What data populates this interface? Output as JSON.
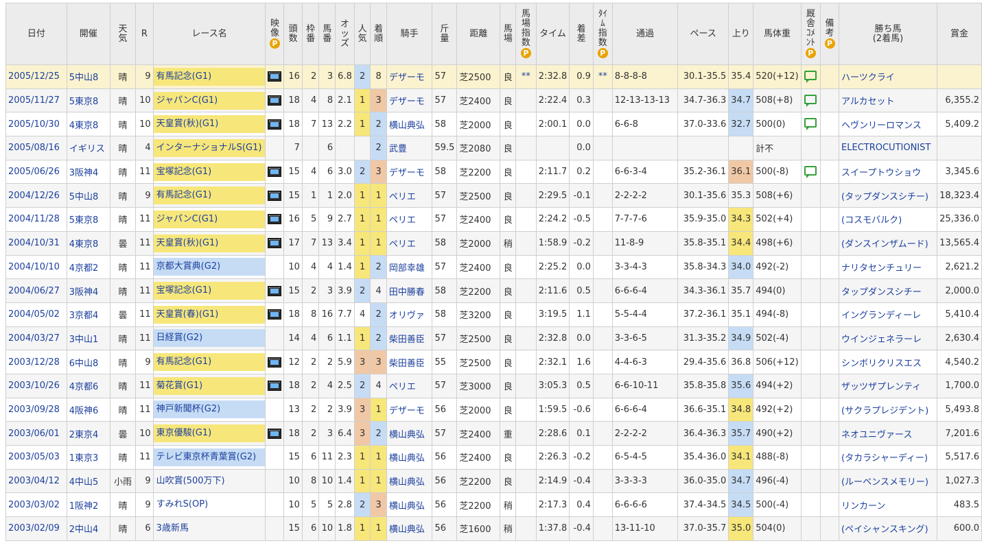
{
  "headers": {
    "date": "日付",
    "venue": "開催",
    "weather": "天気",
    "race_no": "R",
    "race_name": "レース名",
    "video": "映像",
    "video_badge": "P",
    "runners": "頭数",
    "bracket": "枠番",
    "horse_no": "馬番",
    "odds": "オッズ",
    "popularity": "人気",
    "finish": "着順",
    "jockey": "騎手",
    "weight_carried": "斤量",
    "distance": "距離",
    "track": "馬場",
    "track_index": "馬場指数",
    "track_index_badge": "P",
    "time": "タイム",
    "margin": "着差",
    "time_index": "ﾀｲﾑ指数",
    "time_index_badge": "P",
    "passing": "通過",
    "pace": "ペース",
    "last3f": "上り",
    "body_weight": "馬体重",
    "stable_comment": "厩舎ｺﾒﾝﾄ",
    "stable_comment_badge": "P",
    "notes": "備考",
    "notes_badge": "P",
    "winner_l1": "勝ち馬",
    "winner_l2": "(2着馬)",
    "prize": "賞金"
  },
  "rows": [
    {
      "date": "2005/12/25",
      "venue": "5中山8",
      "weather": "晴",
      "race_no": "9",
      "race_name": "有馬記念(G1)",
      "grade": "g1",
      "video": true,
      "runners": "16",
      "bracket": "2",
      "horse_no": "3",
      "odds": "6.8",
      "popularity": "2",
      "finish": "8",
      "jockey": "デザーモ",
      "weight_carried": "57",
      "distance": "芝2500",
      "track": "良",
      "track_index": "**",
      "time": "2:32.8",
      "margin": "0.9",
      "time_index": "**",
      "passing": "8-8-8-8",
      "pace": "30.1-35.5",
      "last3f": "35.4",
      "body_weight": "520(+12)",
      "comment": true,
      "notes": "",
      "winner": "ハーツクライ",
      "prize": ""
    },
    {
      "date": "2005/11/27",
      "venue": "5東京8",
      "weather": "晴",
      "race_no": "10",
      "race_name": "ジャパンC(G1)",
      "grade": "g1",
      "video": true,
      "runners": "18",
      "bracket": "4",
      "horse_no": "8",
      "odds": "2.1",
      "popularity": "1",
      "finish": "3",
      "jockey": "デザーモ",
      "weight_carried": "57",
      "distance": "芝2400",
      "track": "良",
      "track_index": "",
      "time": "2:22.4",
      "margin": "0.3",
      "time_index": "",
      "passing": "12-13-13-13",
      "pace": "34.7-36.3",
      "last3f": "34.7",
      "body_weight": "508(+8)",
      "comment": true,
      "notes": "",
      "winner": "アルカセット",
      "prize": "6,355.2"
    },
    {
      "date": "2005/10/30",
      "venue": "4東京8",
      "weather": "晴",
      "race_no": "10",
      "race_name": "天皇賞(秋)(G1)",
      "grade": "g1",
      "video": true,
      "runners": "18",
      "bracket": "7",
      "horse_no": "13",
      "odds": "2.2",
      "popularity": "1",
      "finish": "2",
      "jockey": "横山典弘",
      "weight_carried": "58",
      "distance": "芝2000",
      "track": "良",
      "track_index": "",
      "time": "2:00.1",
      "margin": "0.0",
      "time_index": "",
      "passing": "6-6-8",
      "pace": "37.0-33.6",
      "last3f": "32.7",
      "body_weight": "500(0)",
      "comment": true,
      "notes": "",
      "winner": "ヘヴンリーロマンス",
      "prize": "5,409.2"
    },
    {
      "date": "2005/08/16",
      "venue": "イギリス",
      "weather": "晴",
      "race_no": "4",
      "race_name": "インターナショナルS(G1)",
      "grade": "g1",
      "video": false,
      "runners": "7",
      "bracket": "",
      "horse_no": "6",
      "odds": "",
      "popularity": "",
      "finish": "2",
      "jockey": "武豊",
      "weight_carried": "59.5",
      "distance": "芝2080",
      "track": "良",
      "track_index": "",
      "time": "",
      "margin": "0.0",
      "time_index": "",
      "passing": "",
      "pace": "",
      "last3f": "",
      "body_weight": "計不",
      "comment": false,
      "notes": "",
      "winner": "ELECTROCUTIONIST",
      "prize": ""
    },
    {
      "date": "2005/06/26",
      "venue": "3阪神4",
      "weather": "晴",
      "race_no": "11",
      "race_name": "宝塚記念(G1)",
      "grade": "g1",
      "video": true,
      "runners": "15",
      "bracket": "4",
      "horse_no": "6",
      "odds": "3.0",
      "popularity": "2",
      "finish": "3",
      "jockey": "デザーモ",
      "weight_carried": "58",
      "distance": "芝2200",
      "track": "良",
      "track_index": "",
      "time": "2:11.7",
      "margin": "0.2",
      "time_index": "",
      "passing": "6-6-3-4",
      "pace": "35.2-36.1",
      "last3f": "36.1",
      "body_weight": "500(-8)",
      "comment": true,
      "notes": "",
      "winner": "スイープトウショウ",
      "prize": "3,345.6"
    },
    {
      "date": "2004/12/26",
      "venue": "5中山8",
      "weather": "晴",
      "race_no": "9",
      "race_name": "有馬記念(G1)",
      "grade": "g1",
      "video": true,
      "runners": "15",
      "bracket": "1",
      "horse_no": "1",
      "odds": "2.0",
      "popularity": "1",
      "finish": "1",
      "jockey": "ペリエ",
      "weight_carried": "57",
      "distance": "芝2500",
      "track": "良",
      "track_index": "",
      "time": "2:29.5",
      "margin": "-0.1",
      "time_index": "",
      "passing": "2-2-2-2",
      "pace": "30.1-35.6",
      "last3f": "35.3",
      "body_weight": "508(+6)",
      "comment": false,
      "notes": "",
      "winner": "(タップダンスシチー)",
      "prize": "18,323.4"
    },
    {
      "date": "2004/11/28",
      "venue": "5東京8",
      "weather": "晴",
      "race_no": "11",
      "race_name": "ジャパンC(G1)",
      "grade": "g1",
      "video": true,
      "runners": "16",
      "bracket": "5",
      "horse_no": "9",
      "odds": "2.7",
      "popularity": "1",
      "finish": "1",
      "jockey": "ペリエ",
      "weight_carried": "57",
      "distance": "芝2400",
      "track": "良",
      "track_index": "",
      "time": "2:24.2",
      "margin": "-0.5",
      "time_index": "",
      "passing": "7-7-7-6",
      "pace": "35.9-35.0",
      "last3f": "34.3",
      "body_weight": "502(+4)",
      "comment": false,
      "notes": "",
      "winner": "(コスモバルク)",
      "prize": "25,336.0"
    },
    {
      "date": "2004/10/31",
      "venue": "4東京8",
      "weather": "曇",
      "race_no": "11",
      "race_name": "天皇賞(秋)(G1)",
      "grade": "g1",
      "video": true,
      "runners": "17",
      "bracket": "7",
      "horse_no": "13",
      "odds": "3.4",
      "popularity": "1",
      "finish": "1",
      "jockey": "ペリエ",
      "weight_carried": "58",
      "distance": "芝2000",
      "track": "稍",
      "track_index": "",
      "time": "1:58.9",
      "margin": "-0.2",
      "time_index": "",
      "passing": "11-8-9",
      "pace": "35.8-35.1",
      "last3f": "34.4",
      "body_weight": "498(+6)",
      "comment": false,
      "notes": "",
      "winner": "(ダンスインザムード)",
      "prize": "13,565.4"
    },
    {
      "date": "2004/10/10",
      "venue": "4京都2",
      "weather": "晴",
      "race_no": "11",
      "race_name": "京都大賞典(G2)",
      "grade": "g2",
      "video": false,
      "runners": "10",
      "bracket": "4",
      "horse_no": "4",
      "odds": "1.4",
      "popularity": "1",
      "finish": "2",
      "jockey": "岡部幸雄",
      "weight_carried": "57",
      "distance": "芝2400",
      "track": "良",
      "track_index": "",
      "time": "2:25.2",
      "margin": "0.0",
      "time_index": "",
      "passing": "3-3-4-3",
      "pace": "35.8-34.3",
      "last3f": "34.0",
      "body_weight": "492(-2)",
      "comment": false,
      "notes": "",
      "winner": "ナリタセンチュリー",
      "prize": "2,621.2"
    },
    {
      "date": "2004/06/27",
      "venue": "3阪神4",
      "weather": "晴",
      "race_no": "11",
      "race_name": "宝塚記念(G1)",
      "grade": "g1",
      "video": true,
      "runners": "15",
      "bracket": "2",
      "horse_no": "3",
      "odds": "3.9",
      "popularity": "2",
      "finish": "4",
      "jockey": "田中勝春",
      "weight_carried": "58",
      "distance": "芝2200",
      "track": "良",
      "track_index": "",
      "time": "2:11.6",
      "margin": "0.5",
      "time_index": "",
      "passing": "6-6-6-4",
      "pace": "34.3-36.1",
      "last3f": "35.7",
      "body_weight": "494(0)",
      "comment": false,
      "notes": "",
      "winner": "タップダンスシチー",
      "prize": "2,000.0"
    },
    {
      "date": "2004/05/02",
      "venue": "3京都4",
      "weather": "曇",
      "race_no": "11",
      "race_name": "天皇賞(春)(G1)",
      "grade": "g1",
      "video": true,
      "runners": "18",
      "bracket": "8",
      "horse_no": "16",
      "odds": "7.7",
      "popularity": "4",
      "finish": "2",
      "jockey": "オリヴァ",
      "weight_carried": "58",
      "distance": "芝3200",
      "track": "良",
      "track_index": "",
      "time": "3:19.5",
      "margin": "1.1",
      "time_index": "",
      "passing": "5-5-4-4",
      "pace": "37.2-36.1",
      "last3f": "35.1",
      "body_weight": "494(-8)",
      "comment": false,
      "notes": "",
      "winner": "イングランディーレ",
      "prize": "5,410.4"
    },
    {
      "date": "2004/03/27",
      "venue": "3中山1",
      "weather": "晴",
      "race_no": "11",
      "race_name": "日経賞(G2)",
      "grade": "g2",
      "video": false,
      "runners": "14",
      "bracket": "4",
      "horse_no": "6",
      "odds": "1.1",
      "popularity": "1",
      "finish": "2",
      "jockey": "柴田善臣",
      "weight_carried": "57",
      "distance": "芝2500",
      "track": "良",
      "track_index": "",
      "time": "2:32.8",
      "margin": "0.0",
      "time_index": "",
      "passing": "3-3-6-5",
      "pace": "31.3-35.2",
      "last3f": "34.9",
      "body_weight": "502(-4)",
      "comment": false,
      "notes": "",
      "winner": "ウインジェネラーレ",
      "prize": "2,630.4"
    },
    {
      "date": "2003/12/28",
      "venue": "6中山8",
      "weather": "晴",
      "race_no": "9",
      "race_name": "有馬記念(G1)",
      "grade": "g1",
      "video": true,
      "runners": "12",
      "bracket": "2",
      "horse_no": "2",
      "odds": "5.9",
      "popularity": "3",
      "finish": "3",
      "jockey": "柴田善臣",
      "weight_carried": "55",
      "distance": "芝2500",
      "track": "良",
      "track_index": "",
      "time": "2:32.1",
      "margin": "1.6",
      "time_index": "",
      "passing": "4-4-6-3",
      "pace": "29.4-35.6",
      "last3f": "36.8",
      "body_weight": "506(+12)",
      "comment": false,
      "notes": "",
      "winner": "シンボリクリスエス",
      "prize": "4,540.2"
    },
    {
      "date": "2003/10/26",
      "venue": "4京都6",
      "weather": "晴",
      "race_no": "11",
      "race_name": "菊花賞(G1)",
      "grade": "g1",
      "video": true,
      "runners": "18",
      "bracket": "2",
      "horse_no": "4",
      "odds": "2.5",
      "popularity": "2",
      "finish": "4",
      "jockey": "ペリエ",
      "weight_carried": "57",
      "distance": "芝3000",
      "track": "良",
      "track_index": "",
      "time": "3:05.3",
      "margin": "0.5",
      "time_index": "",
      "passing": "6-6-10-11",
      "pace": "35.8-35.8",
      "last3f": "35.6",
      "body_weight": "494(+2)",
      "comment": false,
      "notes": "",
      "winner": "ザッツザプレンティ",
      "prize": "1,700.0"
    },
    {
      "date": "2003/09/28",
      "venue": "4阪神6",
      "weather": "晴",
      "race_no": "11",
      "race_name": "神戸新聞杯(G2)",
      "grade": "g2",
      "video": false,
      "runners": "13",
      "bracket": "2",
      "horse_no": "2",
      "odds": "3.9",
      "popularity": "3",
      "finish": "1",
      "jockey": "デザーモ",
      "weight_carried": "56",
      "distance": "芝2000",
      "track": "良",
      "track_index": "",
      "time": "1:59.5",
      "margin": "-0.6",
      "time_index": "",
      "passing": "6-6-6-4",
      "pace": "36.6-35.1",
      "last3f": "34.8",
      "body_weight": "492(+2)",
      "comment": false,
      "notes": "",
      "winner": "(サクラプレジデント)",
      "prize": "5,493.8"
    },
    {
      "date": "2003/06/01",
      "venue": "2東京4",
      "weather": "曇",
      "race_no": "10",
      "race_name": "東京優駿(G1)",
      "grade": "g1",
      "video": true,
      "runners": "18",
      "bracket": "2",
      "horse_no": "3",
      "odds": "6.4",
      "popularity": "3",
      "finish": "2",
      "jockey": "横山典弘",
      "weight_carried": "57",
      "distance": "芝2400",
      "track": "重",
      "track_index": "",
      "time": "2:28.6",
      "margin": "0.1",
      "time_index": "",
      "passing": "2-2-2-2",
      "pace": "36.4-36.3",
      "last3f": "35.7",
      "body_weight": "490(+2)",
      "comment": false,
      "notes": "",
      "winner": "ネオユニヴァース",
      "prize": "7,201.6"
    },
    {
      "date": "2003/05/03",
      "venue": "1東京3",
      "weather": "晴",
      "race_no": "11",
      "race_name": "テレビ東京杯青葉賞(G2)",
      "grade": "g2",
      "video": false,
      "runners": "15",
      "bracket": "6",
      "horse_no": "11",
      "odds": "2.3",
      "popularity": "1",
      "finish": "1",
      "jockey": "横山典弘",
      "weight_carried": "56",
      "distance": "芝2400",
      "track": "良",
      "track_index": "",
      "time": "2:26.3",
      "margin": "-0.2",
      "time_index": "",
      "passing": "6-5-4-5",
      "pace": "35.4-36.0",
      "last3f": "34.1",
      "body_weight": "488(-8)",
      "comment": false,
      "notes": "",
      "winner": "(タカラシャーディー)",
      "prize": "5,517.6"
    },
    {
      "date": "2003/04/12",
      "venue": "4中山5",
      "weather": "小雨",
      "race_no": "9",
      "race_name": "山吹賞(500万下)",
      "grade": "",
      "video": false,
      "runners": "10",
      "bracket": "8",
      "horse_no": "10",
      "odds": "1.4",
      "popularity": "1",
      "finish": "1",
      "jockey": "横山典弘",
      "weight_carried": "56",
      "distance": "芝2200",
      "track": "良",
      "track_index": "",
      "time": "2:14.9",
      "margin": "-0.4",
      "time_index": "",
      "passing": "3-3-3-3",
      "pace": "36.0-35.0",
      "last3f": "34.7",
      "body_weight": "496(-4)",
      "comment": false,
      "notes": "",
      "winner": "(ルーベンスメモリー)",
      "prize": "1,027.3"
    },
    {
      "date": "2003/03/02",
      "venue": "1阪神2",
      "weather": "晴",
      "race_no": "9",
      "race_name": "すみれS(OP)",
      "grade": "",
      "video": false,
      "runners": "10",
      "bracket": "5",
      "horse_no": "5",
      "odds": "2.8",
      "popularity": "2",
      "finish": "3",
      "jockey": "横山典弘",
      "weight_carried": "56",
      "distance": "芝2200",
      "track": "稍",
      "track_index": "",
      "time": "2:17.3",
      "margin": "0.4",
      "time_index": "",
      "passing": "6-6-6-6",
      "pace": "37.4-34.5",
      "last3f": "34.5",
      "body_weight": "500(-4)",
      "comment": false,
      "notes": "",
      "winner": "リンカーン",
      "prize": "483.5"
    },
    {
      "date": "2003/02/09",
      "venue": "2中山4",
      "weather": "晴",
      "race_no": "6",
      "race_name": "3歳新馬",
      "grade": "",
      "video": false,
      "runners": "15",
      "bracket": "6",
      "horse_no": "10",
      "odds": "1.8",
      "popularity": "1",
      "finish": "1",
      "jockey": "横山典弘",
      "weight_carried": "56",
      "distance": "芝1600",
      "track": "稍",
      "track_index": "",
      "time": "1:37.8",
      "margin": "-0.4",
      "time_index": "",
      "passing": "13-11-10",
      "pace": "37.0-35.7",
      "last3f": "35.0",
      "body_weight": "504(0)",
      "comment": false,
      "notes": "",
      "winner": "(ペイシャンスキング)",
      "prize": "600.0"
    }
  ],
  "colors": {
    "highlight_row": "#fbf3cf",
    "alt_row": "#f5f5f5",
    "grade_g1": "#f7e67a",
    "grade_g2": "#c6dcf5",
    "rank_1": "#f7e67a",
    "rank_2": "#c6dcf5",
    "rank_3": "#f0c8a6",
    "link": "#1b3f9d"
  }
}
